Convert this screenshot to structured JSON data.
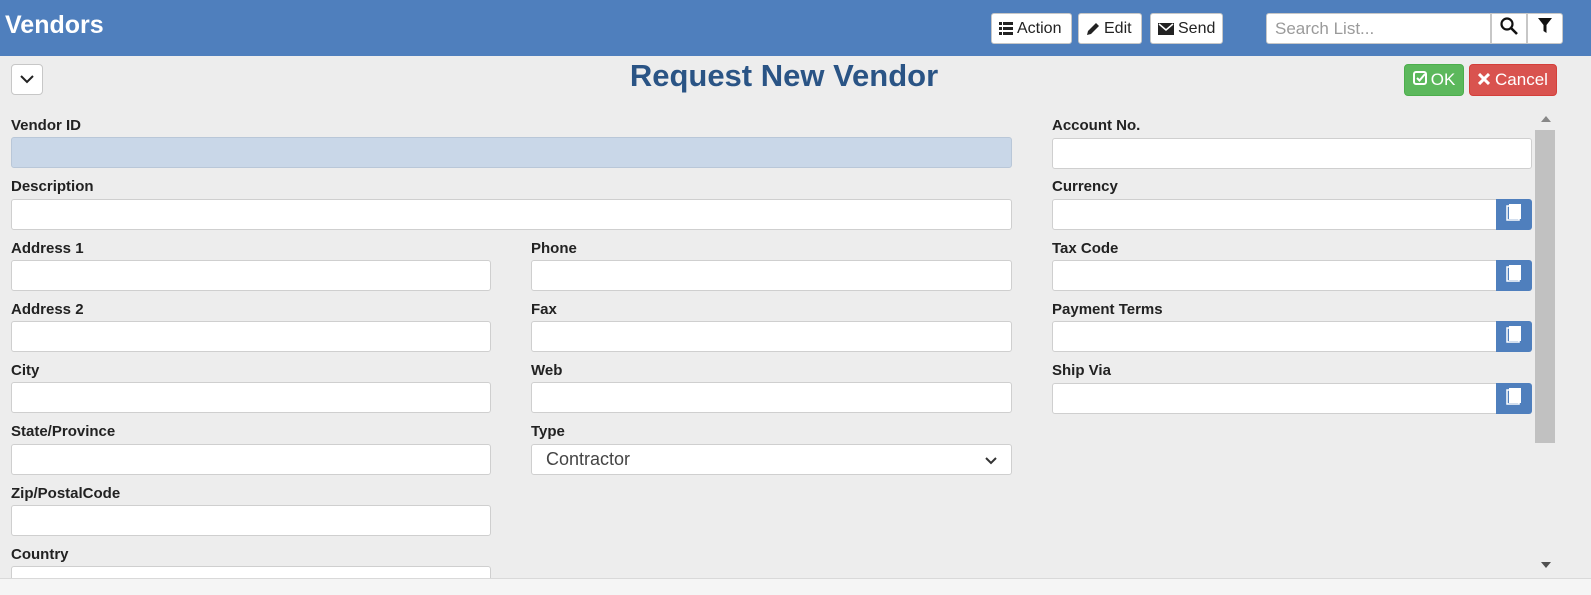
{
  "header": {
    "title": "Vendors",
    "action_label": "Action",
    "edit_label": "Edit",
    "send_label": "Send",
    "search_placeholder": "Search List..."
  },
  "dialog": {
    "title": "Request New Vendor",
    "ok_label": "OK",
    "cancel_label": "Cancel"
  },
  "form": {
    "vendor_id_label": "Vendor ID",
    "description_label": "Description",
    "address1_label": "Address 1",
    "address2_label": "Address 2",
    "city_label": "City",
    "state_label": "State/Province",
    "zip_label": "Zip/PostalCode",
    "country_label": "Country",
    "phone_label": "Phone",
    "fax_label": "Fax",
    "web_label": "Web",
    "type_label": "Type",
    "type_value": "Contractor",
    "account_label": "Account No.",
    "currency_label": "Currency",
    "tax_code_label": "Tax Code",
    "payment_terms_label": "Payment Terms",
    "ship_via_label": "Ship Via"
  },
  "colors": {
    "header_bg": "#4f7fbd",
    "title_color": "#2a5485",
    "ok_green": "#5cb85c",
    "cancel_red": "#d9534f"
  },
  "icons": {
    "action": "list-icon",
    "edit": "pencil-icon",
    "send": "envelope-icon",
    "search": "search-icon",
    "filter": "filter-icon",
    "collapse": "chevron-down-icon",
    "ok": "check-square-icon",
    "cancel": "x-icon",
    "lookup": "book-icon"
  }
}
